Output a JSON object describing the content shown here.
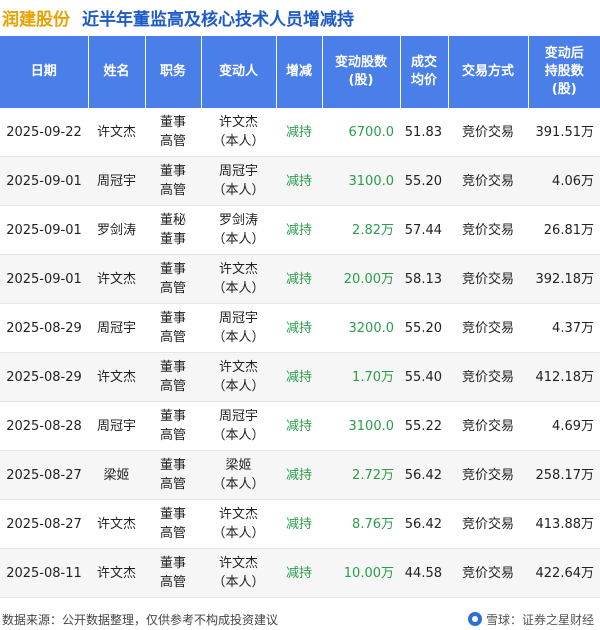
{
  "title": {
    "stock_name": "润建股份",
    "subtitle": "近半年董监高及核心技术人员增减持"
  },
  "columns": [
    "日期",
    "姓名",
    "职务",
    "变动人",
    "增减",
    "变动股数(股)",
    "成交均价",
    "交易方式",
    "变动后持股数(股)"
  ],
  "header_lines": {
    "date": "日期",
    "name": "姓名",
    "position": "职务",
    "changer": "变动人",
    "direction": "增减",
    "volume_1": "变动股数",
    "volume_2": "(股)",
    "price_1": "成交",
    "price_2": "均价",
    "method": "交易方式",
    "after_1": "变动后",
    "after_2": "持股数",
    "after_3": "(股)"
  },
  "rows": [
    {
      "date": "2025-09-22",
      "name": "许文杰",
      "pos1": "董事",
      "pos2": "高管",
      "ch1": "许文杰",
      "ch2": "（本人）",
      "direction": "减持",
      "volume": "6700.0",
      "price": "51.83",
      "method": "竞价交易",
      "after": "391.51万"
    },
    {
      "date": "2025-09-01",
      "name": "周冠宇",
      "pos1": "董事",
      "pos2": "高管",
      "ch1": "周冠宇",
      "ch2": "（本人）",
      "direction": "减持",
      "volume": "3100.0",
      "price": "55.20",
      "method": "竞价交易",
      "after": "4.06万"
    },
    {
      "date": "2025-09-01",
      "name": "罗剑涛",
      "pos1": "董秘",
      "pos2": "董事",
      "ch1": "罗剑涛",
      "ch2": "（本人）",
      "direction": "减持",
      "volume": "2.82万",
      "price": "57.44",
      "method": "竞价交易",
      "after": "26.81万"
    },
    {
      "date": "2025-09-01",
      "name": "许文杰",
      "pos1": "董事",
      "pos2": "高管",
      "ch1": "许文杰",
      "ch2": "（本人）",
      "direction": "减持",
      "volume": "20.00万",
      "price": "58.13",
      "method": "竞价交易",
      "after": "392.18万"
    },
    {
      "date": "2025-08-29",
      "name": "周冠宇",
      "pos1": "董事",
      "pos2": "高管",
      "ch1": "周冠宇",
      "ch2": "（本人）",
      "direction": "减持",
      "volume": "3200.0",
      "price": "55.20",
      "method": "竞价交易",
      "after": "4.37万"
    },
    {
      "date": "2025-08-29",
      "name": "许文杰",
      "pos1": "董事",
      "pos2": "高管",
      "ch1": "许文杰",
      "ch2": "（本人）",
      "direction": "减持",
      "volume": "1.70万",
      "price": "55.40",
      "method": "竞价交易",
      "after": "412.18万"
    },
    {
      "date": "2025-08-28",
      "name": "周冠宇",
      "pos1": "董事",
      "pos2": "高管",
      "ch1": "周冠宇",
      "ch2": "（本人）",
      "direction": "减持",
      "volume": "3100.0",
      "price": "55.22",
      "method": "竞价交易",
      "after": "4.69万"
    },
    {
      "date": "2025-08-27",
      "name": "梁姬",
      "pos1": "董事",
      "pos2": "高管",
      "ch1": "梁姬",
      "ch2": "（本人）",
      "direction": "减持",
      "volume": "2.72万",
      "price": "56.42",
      "method": "竞价交易",
      "after": "258.17万"
    },
    {
      "date": "2025-08-27",
      "name": "许文杰",
      "pos1": "董事",
      "pos2": "高管",
      "ch1": "许文杰",
      "ch2": "（本人）",
      "direction": "减持",
      "volume": "8.76万",
      "price": "56.42",
      "method": "竞价交易",
      "after": "413.88万"
    },
    {
      "date": "2025-08-11",
      "name": "许文杰",
      "pos1": "董事",
      "pos2": "高管",
      "ch1": "许文杰",
      "ch2": "（本人）",
      "direction": "减持",
      "volume": "10.00万",
      "price": "44.58",
      "method": "竞价交易",
      "after": "422.64万"
    }
  ],
  "footer": {
    "source": "数据来源：公开数据整理，仅供参考不构成投资建议",
    "brand": "雪球：证券之星财经",
    "brand_icon": "snowball-logo-icon"
  },
  "colors": {
    "header_bg": "#4a7ee8",
    "title_stock": "#e8a100",
    "title_sub": "#1e5bc6",
    "decrease": "#2a9d4a"
  }
}
